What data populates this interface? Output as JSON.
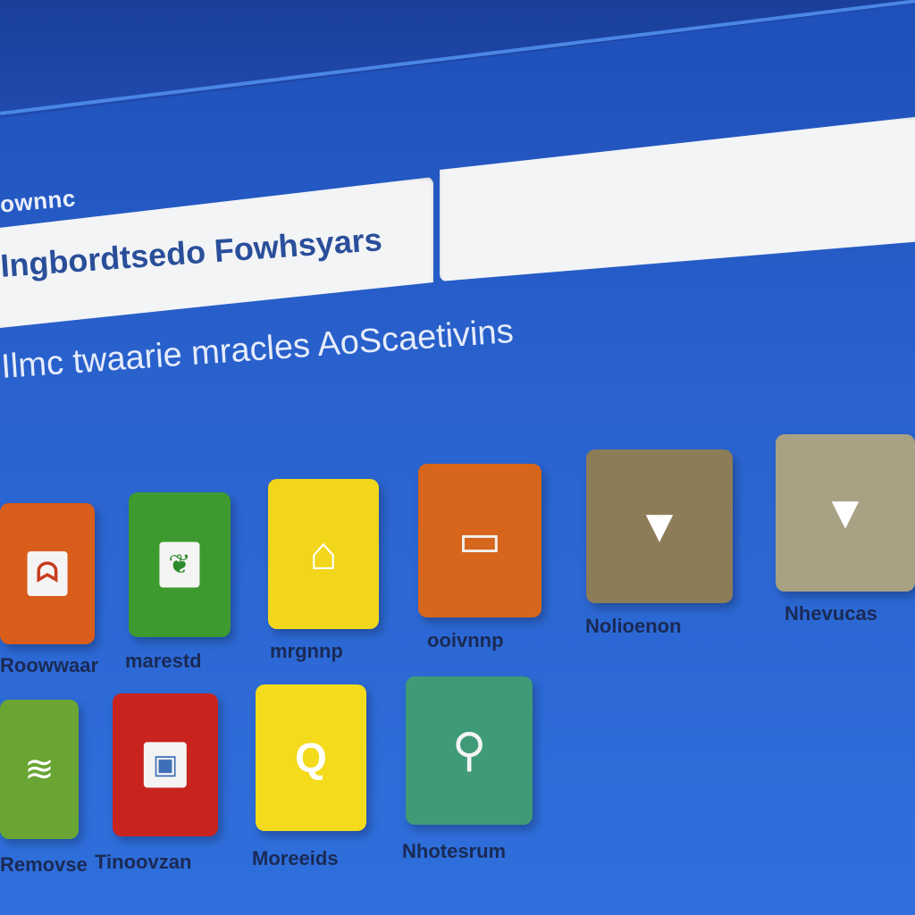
{
  "header": {
    "field_label": "ownnc"
  },
  "search": {
    "value": "Ingbordtsedo Fowhsyars",
    "secondary_value": ""
  },
  "main": {
    "heading": "Ilmc twaarie mracles AoScaetivins"
  },
  "tiles": [
    {
      "label": "Roowwaar",
      "color": "#d95d1a",
      "icon_name": "image-card-icon",
      "icon": "ᗣ"
    },
    {
      "label": "marestd",
      "color": "#3d9a2e",
      "icon_name": "plant-card-icon",
      "icon": "❦"
    },
    {
      "label": "mrgnnp",
      "color": "#f2d61c",
      "icon_name": "house-icon",
      "icon": "⌂"
    },
    {
      "label": "ooivnnp",
      "color": "#d6661c",
      "icon_name": "folder-icon",
      "icon": "▭"
    },
    {
      "label": "Nolioenon",
      "color": "#8c7c58",
      "icon_name": "down-triangle-icon",
      "icon": "▼"
    },
    {
      "label": "Nhevucas",
      "color": "#a9a183",
      "icon_name": "down-arrow-icon",
      "icon": "▼"
    },
    {
      "label": "Removse",
      "color": "#6aa534",
      "icon_name": "chart-card-icon",
      "icon": "≋"
    },
    {
      "label": "Tinoovzan",
      "color": "#c9231f",
      "icon_name": "window-card-icon",
      "icon": "▣"
    },
    {
      "label": "Moreeids",
      "color": "#f4db1b",
      "icon_name": "q-label-icon",
      "icon": "Q"
    },
    {
      "label": "Nhotesrum",
      "color": "#3f9a78",
      "icon_name": "search-stick-icon",
      "icon": "⚲"
    }
  ]
}
